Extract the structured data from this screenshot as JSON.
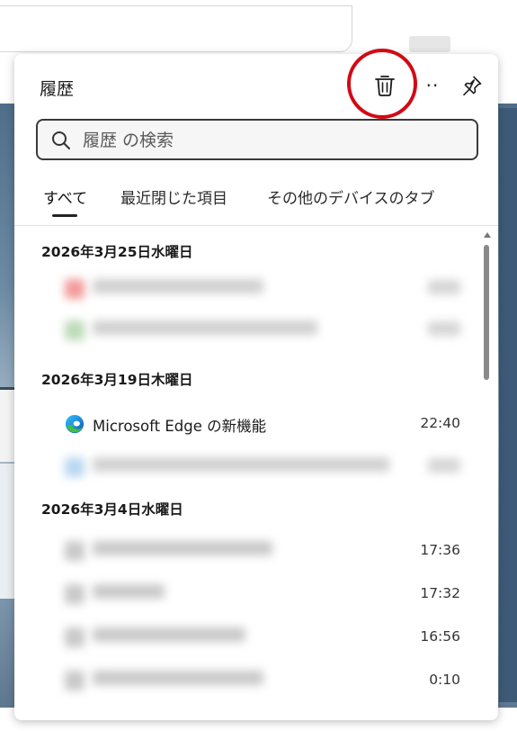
{
  "panel": {
    "title": "履歴",
    "more_label": "··"
  },
  "search": {
    "placeholder": "履歴 の検索"
  },
  "tabs": [
    {
      "label": "すべて"
    },
    {
      "label": "最近閉じた項目"
    },
    {
      "label": "その他のデバイスのタブ"
    }
  ],
  "groups": [
    {
      "date": "2026年3月25日水曜日",
      "items": [
        {
          "title": "",
          "time": ""
        },
        {
          "title": "",
          "time": ""
        }
      ]
    },
    {
      "date": "2026年3月19日木曜日",
      "items": [
        {
          "title": "Microsoft Edge の新機能",
          "time": "22:40",
          "icon": "edge-icon"
        },
        {
          "title": "",
          "time": ""
        }
      ]
    },
    {
      "date": "2026年3月4日水曜日",
      "items": [
        {
          "title": "",
          "time": "17:36"
        },
        {
          "title": "",
          "time": "17:32"
        },
        {
          "title": "",
          "time": "16:56"
        },
        {
          "title": "",
          "time": "0:10"
        }
      ]
    }
  ],
  "colors": {
    "highlight": "#d10a15"
  }
}
